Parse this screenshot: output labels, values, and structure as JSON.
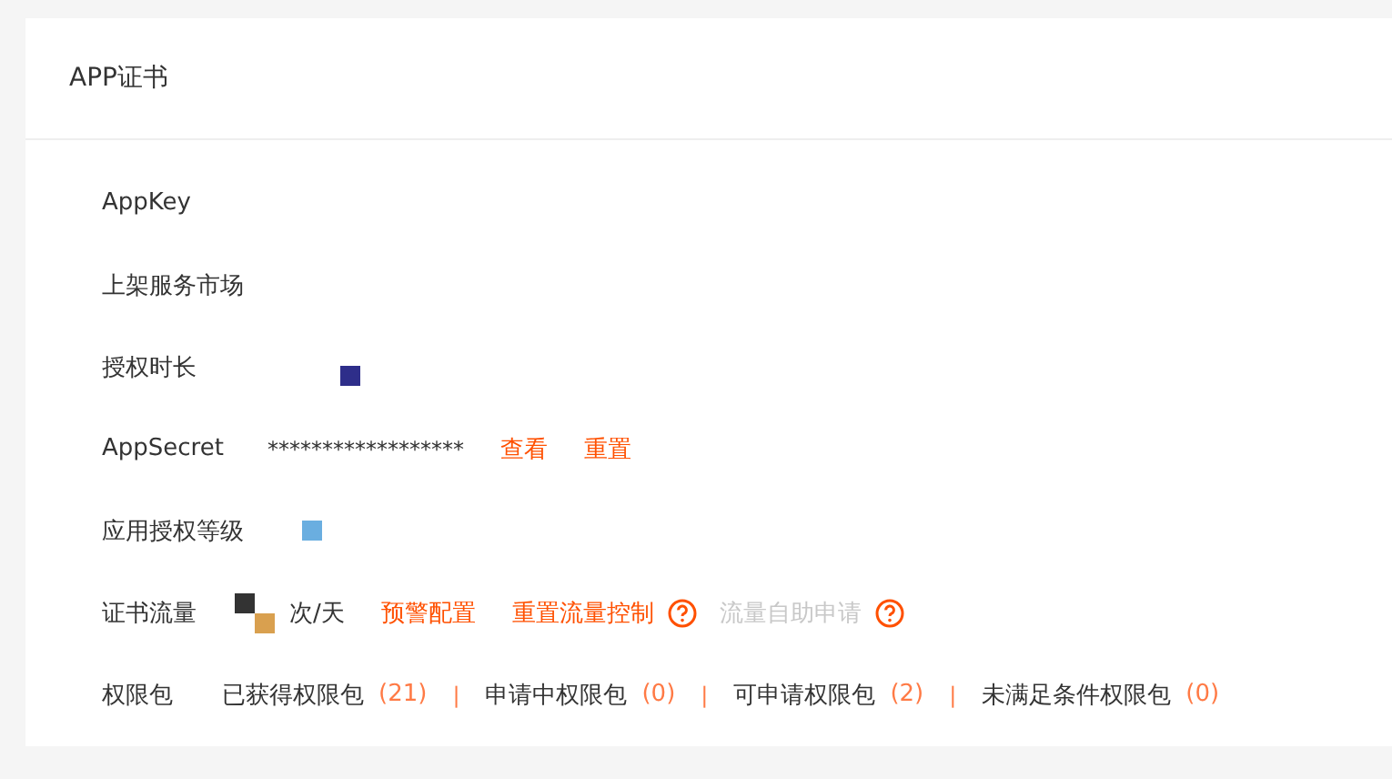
{
  "card": {
    "title": "APP证书"
  },
  "fields": [
    {
      "kind": "text",
      "label": "AppKey"
    },
    {
      "kind": "text",
      "label": "上架服务市场"
    },
    {
      "kind": "text",
      "label": "授权时长",
      "marks": [
        {
          "color": "#2e2e8a"
        }
      ]
    },
    {
      "kind": "secret",
      "label": "AppSecret",
      "value": "******************",
      "actions": [
        {
          "label": "查看",
          "disabled": false,
          "help": false
        },
        {
          "label": "重置",
          "disabled": false,
          "help": false
        }
      ]
    },
    {
      "kind": "text",
      "label": "应用授权等级",
      "marks": [
        {
          "color": "#6aaee0"
        }
      ]
    },
    {
      "kind": "flow",
      "label": "证书流量",
      "value": "次/天",
      "marks": [
        {
          "color": "#333333"
        },
        {
          "color": "#d9a04f"
        }
      ],
      "actions": [
        {
          "label": "预警配置",
          "disabled": false,
          "help": false
        },
        {
          "label": "重置流量控制",
          "disabled": false,
          "help": true
        },
        {
          "label": "流量自助申请",
          "disabled": true,
          "help": true
        }
      ]
    },
    {
      "kind": "packages",
      "label": "权限包",
      "packages": [
        {
          "label": "已获得权限包",
          "count": "(21)"
        },
        {
          "separator": "|",
          "label": "申请中权限包",
          "count": "(0)"
        },
        {
          "separator": "|",
          "label": "可申请权限包",
          "count": "(2)"
        },
        {
          "separator": "|",
          "label": "未满足条件权限包",
          "count": "(0)"
        }
      ]
    }
  ]
}
